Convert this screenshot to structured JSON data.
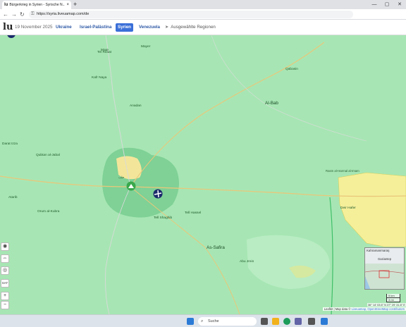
{
  "browser": {
    "tab_title": "Bürgerkrieg in Syrien - Syrische N...",
    "tab_favicon": "lu",
    "tab_close": "×",
    "new_tab": "+",
    "url": "https://syria.liveuamap.com/de",
    "back": "←",
    "forward": "→",
    "reload": "↻",
    "minimize": "—",
    "maximize": "▢",
    "close": "✕"
  },
  "site": {
    "logo": "lu",
    "date": "19 November 2025",
    "tabs": [
      {
        "label": "Ukraine",
        "active": false
      },
      {
        "label": "Israel-Palästina",
        "active": false
      },
      {
        "label": "Syrien",
        "active": true
      },
      {
        "label": "Venezuela",
        "active": false
      }
    ],
    "selected_regions": "Ausgewählte Regionen"
  },
  "map": {
    "labels": {
      "marea": "Mare",
      "tal_rifaat": "Tel Rifaat",
      "kafr_naya": "Kafr Naya",
      "mayer": "Mayer",
      "anadan": "Anadan",
      "qabasin": "Qabasin",
      "al_bab": "Al-Bab",
      "darat_izza": "Darat Izza",
      "qubtan_al_jabal": "Qubtan al-Jabal",
      "urum_al_kubra": "Orum al-Kubra",
      "aleppo_ar": "حلب",
      "atarib": "Atarib",
      "tal_hassel": "Tell Hassel",
      "tal_shaghib": "Tell Shaghib",
      "as_safira": "As-Safira",
      "abu_jrein": "Abu Jrein",
      "deir_hafer": "Deir Hafer",
      "rasm_al_harmal": "Rasm al-Harmal al-Imam",
      "kahramanmaras": "Kahramanmaraş",
      "gaziantep": "Gaziantep"
    },
    "scale_km": "5 km",
    "scale_mi": "3 mi",
    "coords": "36° 14' 03.6\" N 37° 29' 31.6\" E",
    "attribution_prefix": "Leaflet | Map data ©",
    "attribution_link": "Liveuamap, OpenStreetMap contributors",
    "controls": {
      "layers": "◉",
      "arrows": "⇔",
      "locate": "◎",
      "sat": "SAT",
      "zoom_in": "+",
      "zoom_out": "−"
    }
  },
  "taskbar": {
    "search_label": "Suche",
    "search_icon": "⌕"
  },
  "colors": {
    "map_green": "#a7e6b4",
    "urban_green": "#78cf91",
    "yellow_zone": "#f5ef9a",
    "accent_blue": "#3a6fd8"
  }
}
